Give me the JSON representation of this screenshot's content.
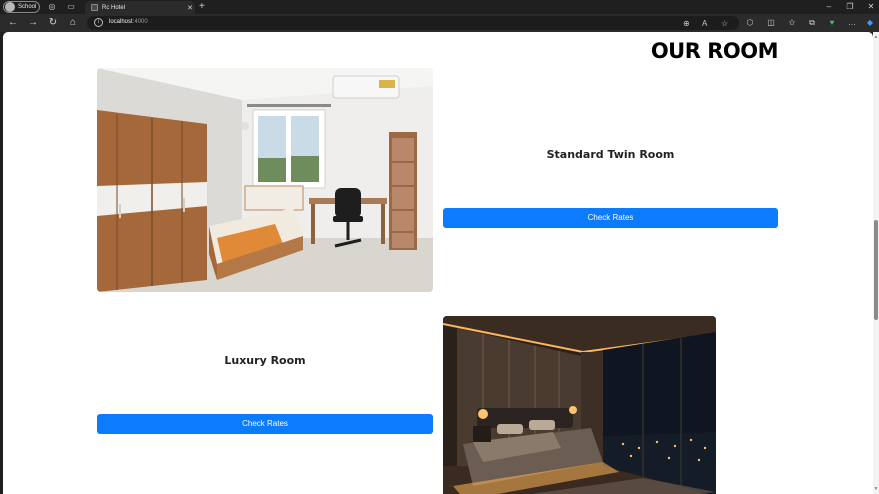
{
  "browser": {
    "profile_name": "School",
    "tab_title": "Rc Hotel",
    "tab_close": "✕",
    "new_tab": "+",
    "url_host": "localhost",
    "url_port": ":4000"
  },
  "page": {
    "heading": "OUR ROOM",
    "rooms": [
      {
        "title": "Standard Twin Room",
        "button": "Check Rates"
      },
      {
        "title": "Luxury Room",
        "button": "Check Rates"
      }
    ]
  },
  "colors": {
    "accent": "#0d7bfd",
    "chrome_dark": "#1f1f1f"
  }
}
